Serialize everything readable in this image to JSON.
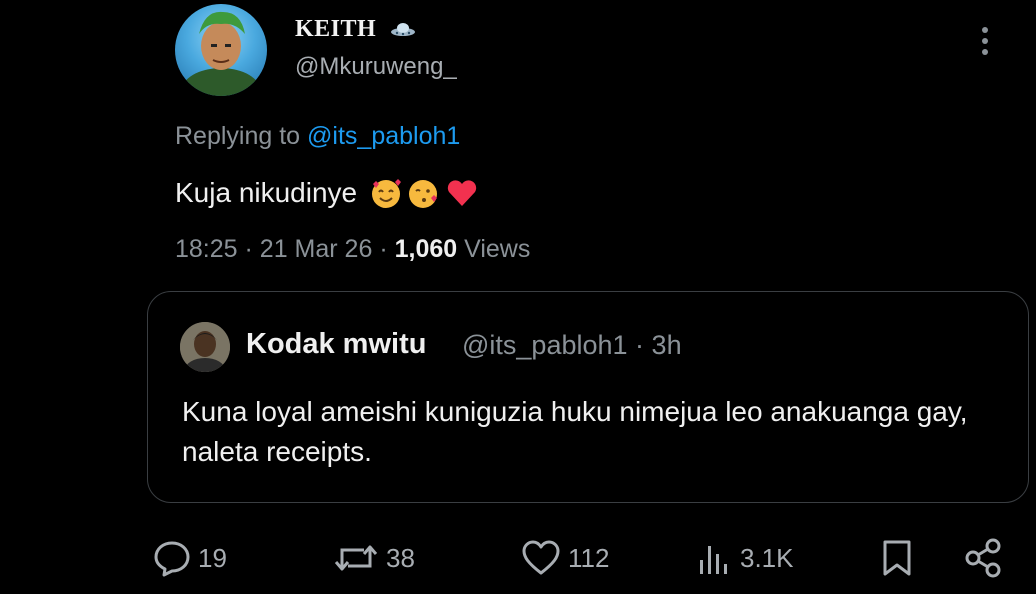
{
  "tweet": {
    "author_name": "KEITH",
    "author_handle": "@Mkuruweng_",
    "replying_prefix": "Replying to",
    "replying_handle": "@its_pabloh1",
    "text": "Kuja nikudinye",
    "emojis": [
      "smiling-face-with-hearts",
      "face-blowing-kiss",
      "red-heart"
    ],
    "time": "18:25",
    "date": "21 Mar 26",
    "views_count": "1,060",
    "views_label": "Views"
  },
  "quoted_tweet": {
    "author_name": "Kodak mwitu",
    "author_handle": "@its_pabloh1",
    "age": "3h",
    "text": "Kuna loyal ameishi kuniguzia huku nimejua leo anakuanga gay, naleta receipts."
  },
  "actions": {
    "replies": "19",
    "retweets": "38",
    "likes": "112",
    "views": "3.1K"
  },
  "colors": {
    "background": "#000000",
    "text": "#e7e9ea",
    "muted": "#8b9298",
    "accent": "#1d9bf0",
    "border": "#3a3e42"
  },
  "icons": [
    "more-vertical-icon",
    "ufo-icon",
    "reply-icon",
    "retweet-icon",
    "like-icon",
    "analytics-icon",
    "bookmark-icon",
    "share-icon"
  ]
}
